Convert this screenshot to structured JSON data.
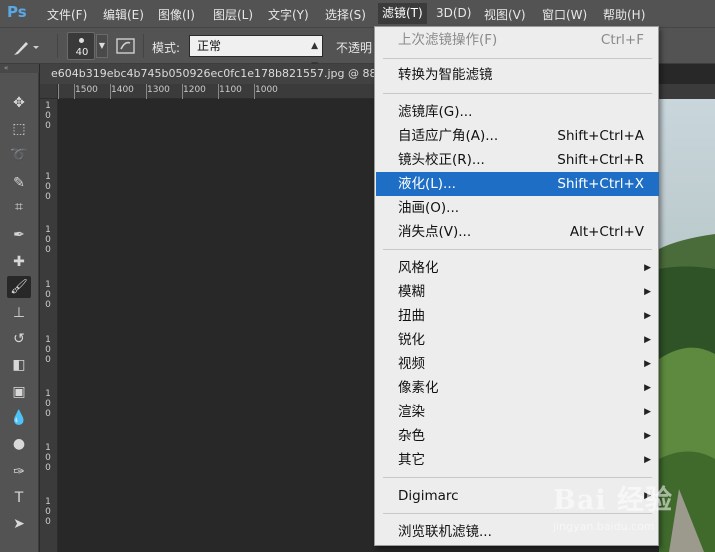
{
  "app": {
    "logo": "Ps"
  },
  "menubar": {
    "items": [
      "文件(F)",
      "编辑(E)",
      "图像(I)",
      "图层(L)",
      "文字(Y)",
      "选择(S)",
      "滤镜(T)",
      "3D(D)",
      "视图(V)",
      "窗口(W)",
      "帮助(H)"
    ],
    "active": "滤镜(T)"
  },
  "options": {
    "brush_size": "40",
    "mode_label": "模式:",
    "mode_value": "正常",
    "opacity_label": "不透明"
  },
  "document": {
    "tab_title": "e604b319ebc4b745b050926ec0fc1e178b821557.jpg @ 88",
    "ruler_h": [
      "1500",
      "1400",
      "1300",
      "1200",
      "1100",
      "1000"
    ],
    "ruler_v": [
      [
        "1",
        "0",
        "0"
      ],
      [
        "1",
        "0",
        "0"
      ],
      [
        "1",
        "0",
        "0"
      ],
      [
        "1",
        "0",
        "0"
      ],
      [
        "1",
        "0",
        "0"
      ],
      [
        "1",
        "0",
        "0"
      ],
      [
        "1",
        "0",
        "0"
      ],
      [
        "1",
        "0",
        "0"
      ]
    ]
  },
  "filter_menu": {
    "last_filter": {
      "label": "上次滤镜操作(F)",
      "shortcut": "Ctrl+F"
    },
    "smart_filter": "转换为智能滤镜",
    "gallery": {
      "label": "滤镜库(G)..."
    },
    "adaptive_wide": {
      "label": "自适应广角(A)...",
      "shortcut": "Shift+Ctrl+A"
    },
    "lens_correction": {
      "label": "镜头校正(R)...",
      "shortcut": "Shift+Ctrl+R"
    },
    "liquify": {
      "label": "液化(L)...",
      "shortcut": "Shift+Ctrl+X"
    },
    "oil_paint": {
      "label": "油画(O)..."
    },
    "vanishing_point": {
      "label": "消失点(V)...",
      "shortcut": "Alt+Ctrl+V"
    },
    "submenus": [
      "风格化",
      "模糊",
      "扭曲",
      "锐化",
      "视频",
      "像素化",
      "渲染",
      "杂色",
      "其它"
    ],
    "digimarc": "Digimarc",
    "browse_online": "浏览联机滤镜...",
    "submenu_arrow": "▶"
  },
  "watermark": {
    "text": "Bai 经验",
    "url": "jingyan.baidu.com"
  },
  "colors": {
    "highlight": "#1e6ec5",
    "chrome": "#535353",
    "canvas": "#282828"
  }
}
